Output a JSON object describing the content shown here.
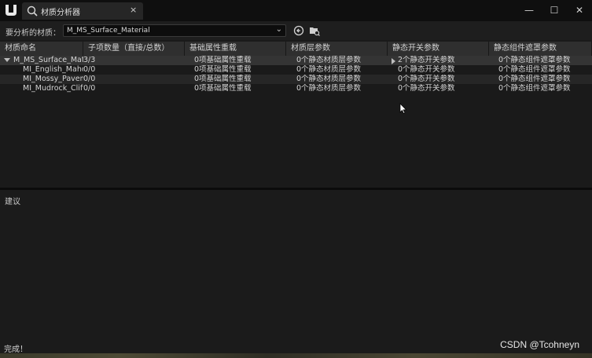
{
  "window": {
    "tab_title": "材质分析器",
    "tab_close": "×",
    "minimize": "—",
    "maximize": "☐",
    "close": "✕"
  },
  "toolbar": {
    "label": "要分析的材质：",
    "selected_material": "M_MS_Surface_Material",
    "dropdown_arrow": "⌄"
  },
  "table": {
    "columns": [
      "材质命名",
      "子项数量（直接/总数）",
      "基础属性重载",
      "材质层参数",
      "静态开关参数",
      "静态组件遮罩参数"
    ],
    "rows": [
      {
        "name": "M_MS_Surface_Material",
        "children": "3/3",
        "base": "0项基础属性重载",
        "layer": "0个静态材质层参数",
        "switch": "2个静态开关参数",
        "mask": "0个静态组件遮罩参数",
        "expanded": true,
        "switch_expander": true
      },
      {
        "name": "MI_English_Mahogany",
        "children": "0/0",
        "base": "0项基础属性重载",
        "layer": "0个静态材质层参数",
        "switch": "0个静态开关参数",
        "mask": "0个静态组件遮罩参数"
      },
      {
        "name": "MI_Mossy_Pavement",
        "children": "0/0",
        "base": "0项基础属性重载",
        "layer": "0个静态材质层参数",
        "switch": "0个静态开关参数",
        "mask": "0个静态组件遮罩参数"
      },
      {
        "name": "MI_Mudrock_Cliff",
        "children": "0/0",
        "base": "0项基础属性重载",
        "layer": "0个静态材质层参数",
        "switch": "0个静态开关参数",
        "mask": "0个静态组件遮罩参数"
      }
    ]
  },
  "suggestions": {
    "label": "建议"
  },
  "status": {
    "text": "完成！"
  },
  "watermark": "CSDN @Tcohneyn",
  "colors": {
    "background": "#1a1a1a",
    "header": "#2f2f2f",
    "selected_row": "#343434"
  }
}
